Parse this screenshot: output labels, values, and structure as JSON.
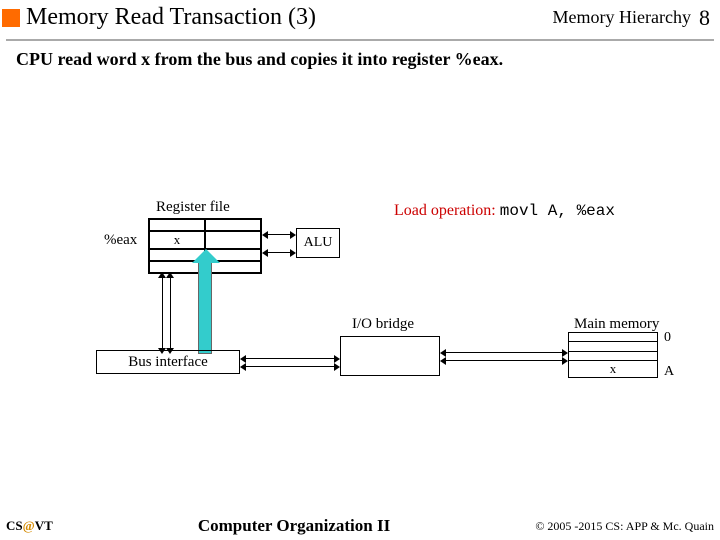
{
  "header": {
    "title": "Memory Read Transaction (3)",
    "topic": "Memory Hierarchy",
    "page": "8"
  },
  "subtitle": "CPU read word x from the bus and copies it into register %eax.",
  "regfile": {
    "label": "Register file",
    "eax_label": "%eax",
    "cell_x": "x"
  },
  "alu": {
    "label": "ALU"
  },
  "load_op": {
    "prefix": "Load operation:",
    "instr": "movl A, %eax"
  },
  "bus_interface": {
    "label": "Bus interface"
  },
  "io_bridge": {
    "label": "I/O bridge"
  },
  "main_memory": {
    "label": "Main memory",
    "addr0": "0",
    "addrA": "A",
    "cell_x": "x"
  },
  "footer": {
    "left_cs": "CS",
    "left_at": "@",
    "left_vt": "VT",
    "center": "Computer Organization II",
    "right": "© 2005 -2015 CS: APP & Mc. Quain"
  }
}
